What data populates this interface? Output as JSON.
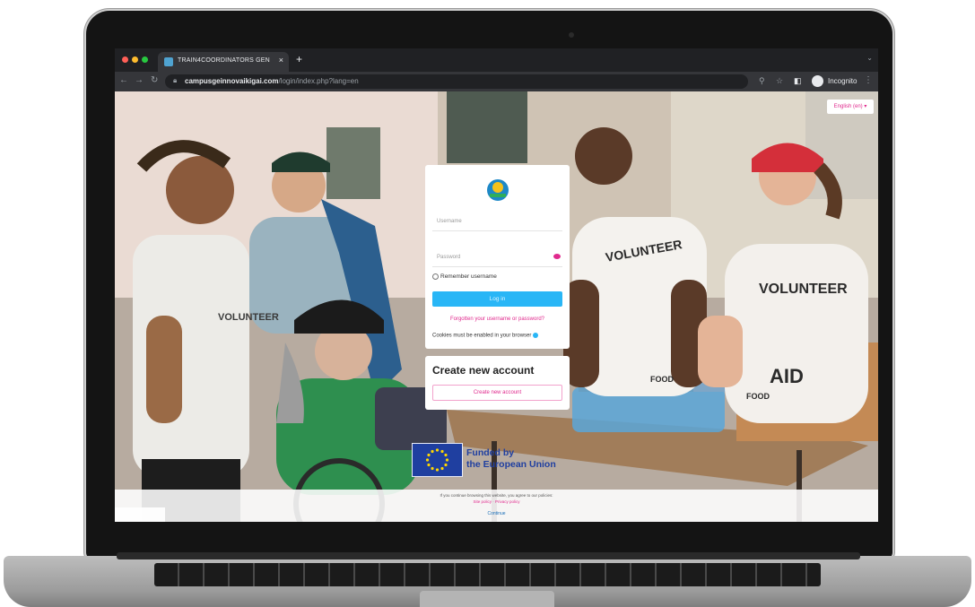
{
  "browser": {
    "tab_title": "TRAIN4COORDINATORS GEN",
    "tab_close": "×",
    "new_tab": "+",
    "url_host": "campusgeinnovaikigai.com",
    "url_path": "/login/index.php?lang=en",
    "profile_label": "Incognito",
    "icons": [
      "back-icon",
      "forward-icon",
      "reload-icon",
      "lock-icon",
      "zoom-icon",
      "star-icon",
      "side-panel-icon",
      "incognito-icon",
      "menu-icon"
    ],
    "traffic_light_colors": [
      "#ff5f57",
      "#febc2e",
      "#28c840"
    ]
  },
  "page": {
    "language_button": "English (en) ▾",
    "login": {
      "username_placeholder": "Username",
      "password_placeholder": "Password",
      "remember_label": "Remember username",
      "login_button": "Log in",
      "forgot_link": "Forgotten your username or password?",
      "cookies_notice": "Cookies must be enabled in your browser"
    },
    "create_account": {
      "title": "Create new account",
      "button": "Create new account"
    },
    "funding": {
      "line1": "Funded by",
      "line2": "the European Union"
    },
    "cookie_banner": {
      "text": "If you continue browsing this website, you agree to our policies:",
      "links": "Site policy · Privacy policy",
      "continue": "Continue"
    },
    "photo_labels": {
      "shirt1": "VOLUNTEER",
      "shirt2": "VOLUNTEER",
      "shirt3": "VOLUNTEER",
      "box1": "FOOD",
      "box2": "AID",
      "box3": "FOOD"
    }
  },
  "colors": {
    "accent_pink": "#e0298d",
    "login_blue": "#29b6f6",
    "eu_blue": "#1f3fa0"
  }
}
